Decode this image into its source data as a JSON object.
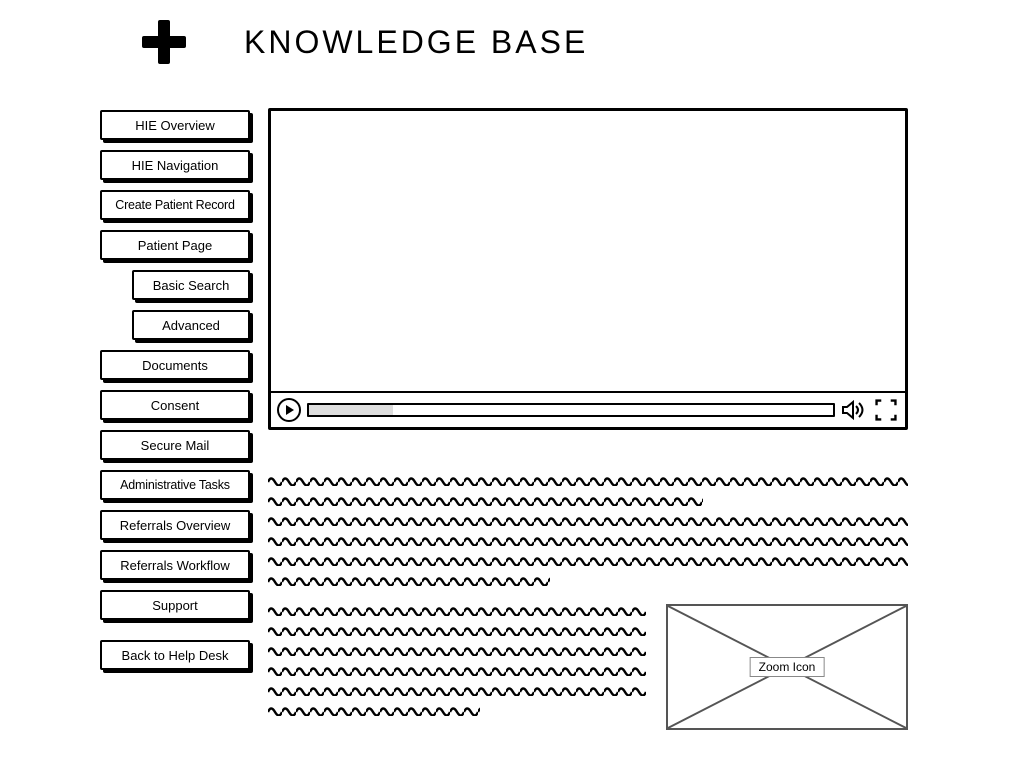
{
  "header": {
    "title": "KNOWLEDGE BASE",
    "icon": "plus-icon"
  },
  "sidebar": {
    "items": [
      {
        "label": "HIE Overview",
        "indent": false
      },
      {
        "label": "HIE Navigation",
        "indent": false
      },
      {
        "label": "Create Patient Record",
        "indent": false,
        "tight": true
      },
      {
        "label": "Patient Page",
        "indent": false
      },
      {
        "label": "Basic Search",
        "indent": true
      },
      {
        "label": "Advanced",
        "indent": true
      },
      {
        "label": "Documents",
        "indent": false
      },
      {
        "label": "Consent",
        "indent": false
      },
      {
        "label": "Secure Mail",
        "indent": false
      },
      {
        "label": "Administrative Tasks",
        "indent": false,
        "tight": true
      },
      {
        "label": "Referrals Overview",
        "indent": false
      },
      {
        "label": "Referrals Workflow",
        "indent": false
      },
      {
        "label": "Support",
        "indent": false
      },
      {
        "label": "Back to Help Desk",
        "indent": false,
        "gap_before": true
      }
    ]
  },
  "main": {
    "video": {
      "progress_percent": 16,
      "play_icon": "play-icon",
      "volume_icon": "volume-icon",
      "fullscreen_icon": "fullscreen-icon"
    },
    "image_placeholder": {
      "label": "Zoom Icon"
    }
  }
}
